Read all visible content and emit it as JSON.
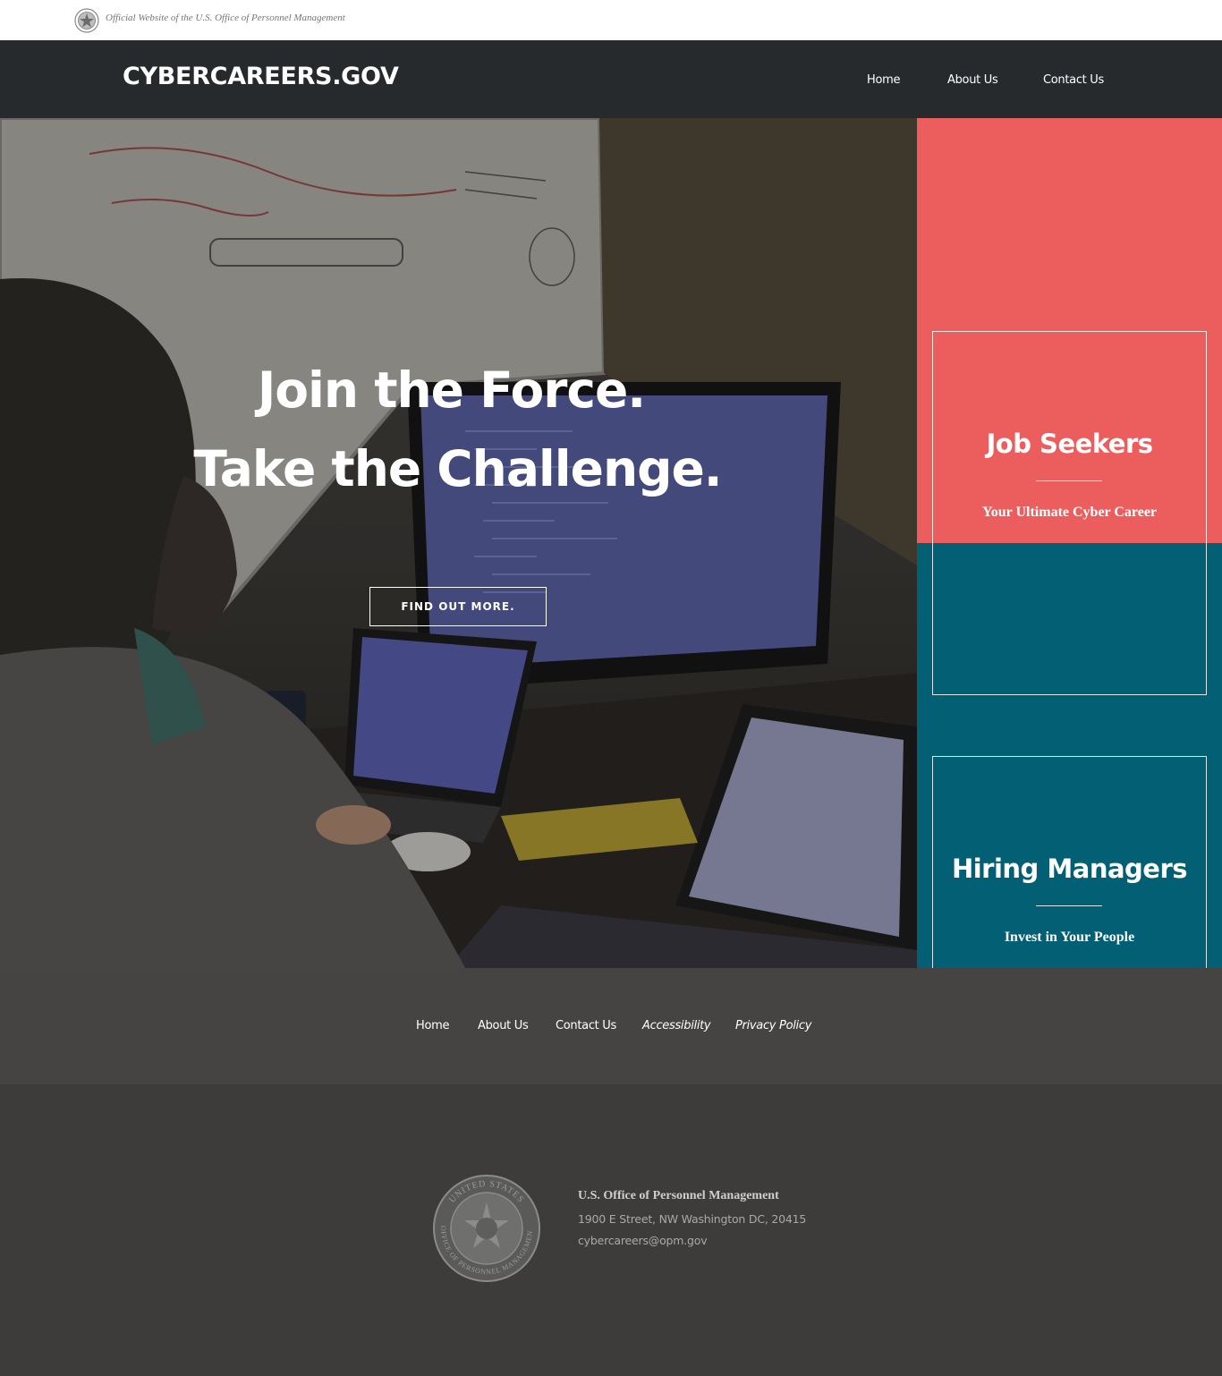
{
  "banner": {
    "text": "Official Website of the U.S. Office of Personnel Management",
    "seal_icon": "opm-seal-icon"
  },
  "header": {
    "brand": "CYBERCAREERS.GOV",
    "nav": [
      {
        "label": "Home"
      },
      {
        "label": "About Us"
      },
      {
        "label": "Contact Us"
      }
    ]
  },
  "hero": {
    "line1": "Join the Force.",
    "line2": "Take the Challenge.",
    "cta_label": "FIND OUT MORE."
  },
  "cards": {
    "job_seekers": {
      "title": "Job Seekers",
      "subtitle": "Your Ultimate Cyber Career",
      "color": "#ec5e5d"
    },
    "hiring_managers": {
      "title": "Hiring Managers",
      "subtitle": "Invest in Your People",
      "color": "#035f73"
    }
  },
  "footer": {
    "nav": [
      {
        "label": "Home"
      },
      {
        "label": "About Us"
      },
      {
        "label": "Contact Us"
      },
      {
        "label": "Accessibility"
      },
      {
        "label": "Privacy Policy"
      }
    ],
    "org": {
      "name": "U.S. Office of Personnel Management",
      "address": "1900 E Street, NW Washington DC, 20415",
      "email": "cybercareers@opm.gov",
      "seal_outer_text": "UNITED STATES",
      "seal_inner_text": "OFFICE OF PERSONNEL MANAGEMENT"
    }
  }
}
